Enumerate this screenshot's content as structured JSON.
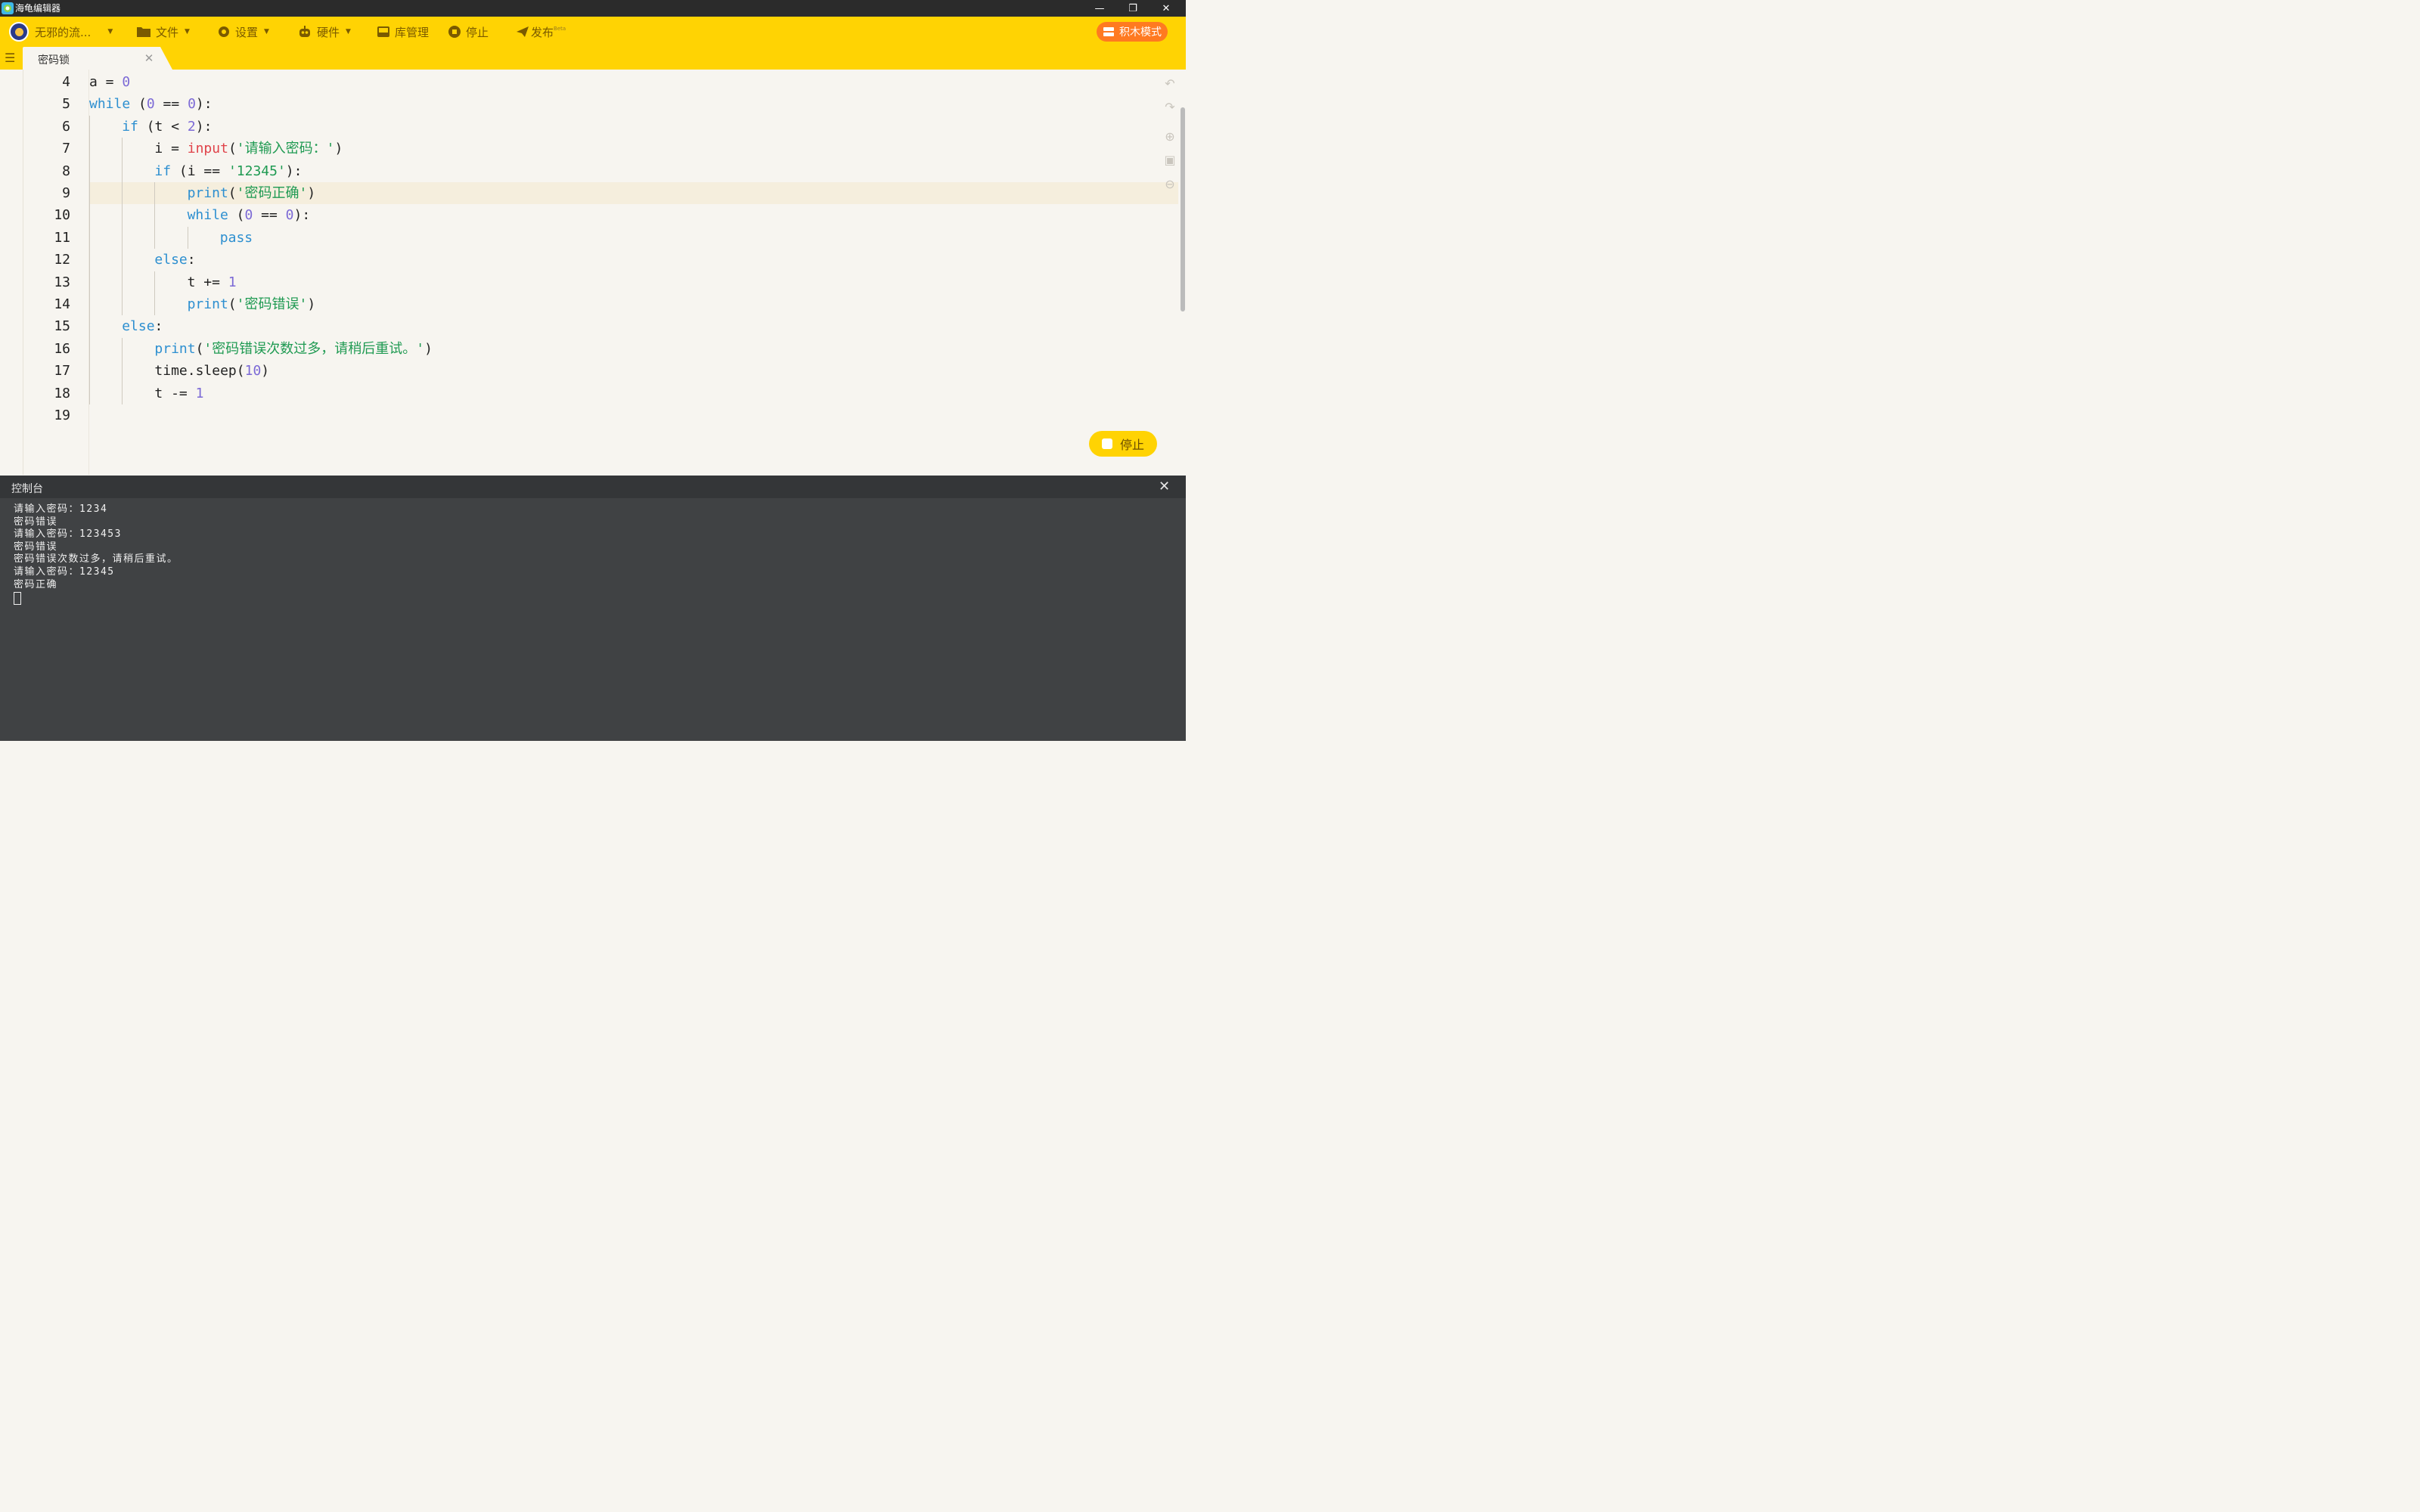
{
  "window": {
    "title": "海龟编辑器",
    "controls": [
      "—",
      "❐",
      "✕"
    ]
  },
  "toolbar": {
    "user": "无邪的流...",
    "file": "文件",
    "settings": "设置",
    "hardware": "硬件",
    "library": "库管理",
    "stop": "停止",
    "publish": "发布",
    "publish_badge": "Beta",
    "block_mode": "积木模式"
  },
  "tab": {
    "label": "密码锁",
    "close": "✕"
  },
  "editor": {
    "active_line": 9,
    "lines": [
      {
        "no": "4",
        "indent": 0,
        "tokens": [
          [
            "t",
            "a = "
          ],
          [
            "num",
            "0"
          ]
        ]
      },
      {
        "no": "5",
        "indent": 0,
        "tokens": [
          [
            "kw",
            "while"
          ],
          [
            "t",
            " ("
          ],
          [
            "num",
            "0"
          ],
          [
            "t",
            " == "
          ],
          [
            "num",
            "0"
          ],
          [
            "t",
            "):"
          ]
        ]
      },
      {
        "no": "6",
        "indent": 1,
        "tokens": [
          [
            "kw",
            "if"
          ],
          [
            "t",
            " (t < "
          ],
          [
            "num",
            "2"
          ],
          [
            "t",
            "):"
          ]
        ]
      },
      {
        "no": "7",
        "indent": 2,
        "tokens": [
          [
            "t",
            "i = "
          ],
          [
            "fn",
            "input"
          ],
          [
            "t",
            "("
          ],
          [
            "str",
            "'请输入密码：'"
          ],
          [
            "t",
            ")"
          ]
        ]
      },
      {
        "no": "8",
        "indent": 2,
        "tokens": [
          [
            "kw",
            "if"
          ],
          [
            "t",
            " (i == "
          ],
          [
            "str",
            "'12345'"
          ],
          [
            "t",
            "):"
          ]
        ]
      },
      {
        "no": "9",
        "indent": 3,
        "tokens": [
          [
            "kw",
            "print"
          ],
          [
            "t",
            "("
          ],
          [
            "str",
            "'密码正确'"
          ],
          [
            "t",
            ")"
          ]
        ]
      },
      {
        "no": "10",
        "indent": 3,
        "tokens": [
          [
            "kw",
            "while"
          ],
          [
            "t",
            " ("
          ],
          [
            "num",
            "0"
          ],
          [
            "t",
            " == "
          ],
          [
            "num",
            "0"
          ],
          [
            "t",
            "):"
          ]
        ]
      },
      {
        "no": "11",
        "indent": 4,
        "tokens": [
          [
            "kw",
            "pass"
          ]
        ]
      },
      {
        "no": "12",
        "indent": 2,
        "tokens": [
          [
            "kw",
            "else"
          ],
          [
            "t",
            ":"
          ]
        ]
      },
      {
        "no": "13",
        "indent": 3,
        "tokens": [
          [
            "t",
            "t += "
          ],
          [
            "num",
            "1"
          ]
        ]
      },
      {
        "no": "14",
        "indent": 3,
        "tokens": [
          [
            "kw",
            "print"
          ],
          [
            "t",
            "("
          ],
          [
            "str",
            "'密码错误'"
          ],
          [
            "t",
            ")"
          ]
        ]
      },
      {
        "no": "15",
        "indent": 1,
        "tokens": [
          [
            "kw",
            "else"
          ],
          [
            "t",
            ":"
          ]
        ]
      },
      {
        "no": "16",
        "indent": 2,
        "tokens": [
          [
            "kw",
            "print"
          ],
          [
            "t",
            "("
          ],
          [
            "str",
            "'密码错误次数过多，请稍后重试。'"
          ],
          [
            "t",
            ")"
          ]
        ]
      },
      {
        "no": "17",
        "indent": 2,
        "tokens": [
          [
            "t",
            "time.sleep("
          ],
          [
            "num",
            "10"
          ],
          [
            "t",
            ")"
          ]
        ]
      },
      {
        "no": "18",
        "indent": 2,
        "tokens": [
          [
            "t",
            "t -= "
          ],
          [
            "num",
            "1"
          ]
        ]
      },
      {
        "no": "19",
        "indent": 0,
        "tokens": []
      }
    ]
  },
  "float_stop": "停止",
  "console": {
    "title": "控制台",
    "close": "✕",
    "lines": [
      "请输入密码：1234",
      "密码错误",
      "请输入密码：123453",
      "密码错误",
      "密码错误次数过多，请稍后重试。",
      "请输入密码：12345",
      "密码正确"
    ]
  },
  "colors": {
    "toolbar": "#ffd303",
    "block_mode": "#ff7a20",
    "keyword": "#2d8fd0",
    "string": "#1f9a52",
    "number": "#7c6ad6",
    "builtin_red": "#e0434a"
  }
}
